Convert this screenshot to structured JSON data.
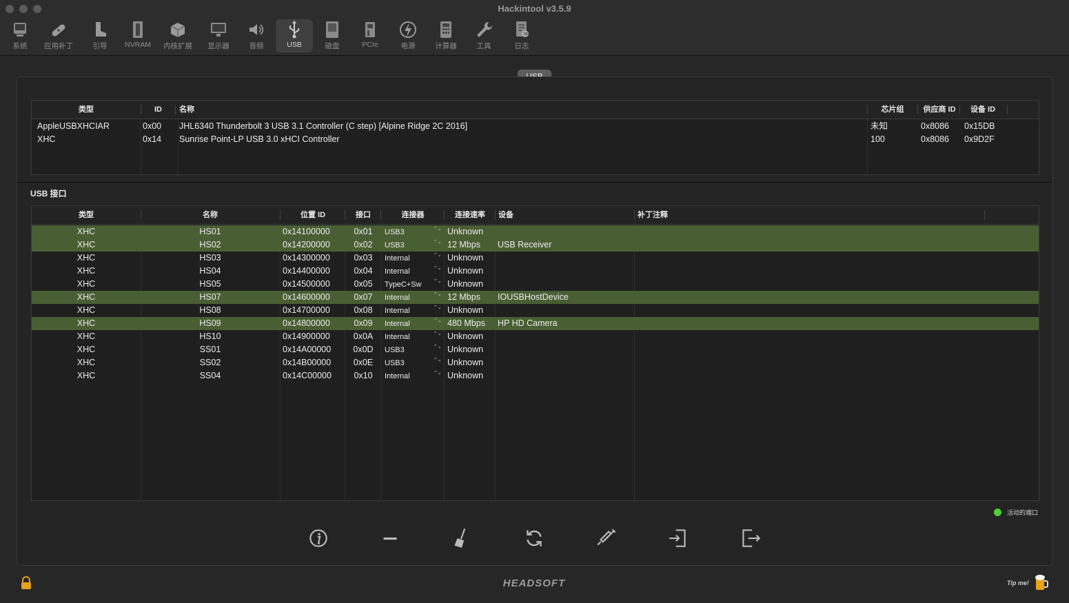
{
  "window": {
    "title": "Hackintool v3.5.9"
  },
  "toolbar": {
    "items": [
      {
        "label": "系统",
        "icon": "computer-icon"
      },
      {
        "label": "应用补丁",
        "icon": "bandage-icon"
      },
      {
        "label": "引导",
        "icon": "boot-icon"
      },
      {
        "label": "NVRAM",
        "icon": "nvram-chip-icon"
      },
      {
        "label": "内核扩展",
        "icon": "kext-box-icon"
      },
      {
        "label": "显示器",
        "icon": "display-icon"
      },
      {
        "label": "音频",
        "icon": "speaker-icon"
      },
      {
        "label": "USB",
        "icon": "usb-icon"
      },
      {
        "label": "磁盘",
        "icon": "disk-icon"
      },
      {
        "label": "PCIe",
        "icon": "pcie-card-icon"
      },
      {
        "label": "电源",
        "icon": "power-bolt-icon"
      },
      {
        "label": "计算器",
        "icon": "calculator-icon"
      },
      {
        "label": "工具",
        "icon": "wrench-icon"
      },
      {
        "label": "日志",
        "icon": "log-icon"
      }
    ],
    "active": "USB"
  },
  "panel": {
    "tab_label": "USB"
  },
  "controllers": {
    "headers": [
      "类型",
      "ID",
      "名称",
      "芯片组",
      "供应商 ID",
      "设备 ID"
    ],
    "rows": [
      [
        "AppleUSBXHCIAR",
        "0x00",
        "JHL6340 Thunderbolt 3 USB 3.1 Controller (C step) [Alpine Ridge 2C 2016]",
        "未知",
        "0x8086",
        "0x15DB"
      ],
      [
        "XHC",
        "0x14",
        "Sunrise Point-LP USB 3.0 xHCI Controller",
        "100",
        "0x8086",
        "0x9D2F"
      ]
    ]
  },
  "ports": {
    "section_title": "USB 接口",
    "headers": [
      "类型",
      "名称",
      "位置 ID",
      "接口",
      "连接器",
      "连接速率",
      "设备",
      "补丁注释"
    ],
    "rows": [
      {
        "cells": [
          "XHC",
          "HS01",
          "0x14100000",
          "0x01",
          "USB3",
          "Unknown",
          "",
          ""
        ],
        "active": true
      },
      {
        "cells": [
          "XHC",
          "HS02",
          "0x14200000",
          "0x02",
          "USB3",
          "12 Mbps",
          "USB Receiver",
          ""
        ],
        "active": true
      },
      {
        "cells": [
          "XHC",
          "HS03",
          "0x14300000",
          "0x03",
          "Internal",
          "Unknown",
          "",
          ""
        ],
        "active": false
      },
      {
        "cells": [
          "XHC",
          "HS04",
          "0x14400000",
          "0x04",
          "Internal",
          "Unknown",
          "",
          ""
        ],
        "active": false
      },
      {
        "cells": [
          "XHC",
          "HS05",
          "0x14500000",
          "0x05",
          "TypeC+Sw",
          "Unknown",
          "",
          ""
        ],
        "active": false
      },
      {
        "cells": [
          "XHC",
          "HS07",
          "0x14600000",
          "0x07",
          "Internal",
          "12 Mbps",
          "IOUSBHostDevice",
          ""
        ],
        "active": true
      },
      {
        "cells": [
          "XHC",
          "HS08",
          "0x14700000",
          "0x08",
          "Internal",
          "Unknown",
          "",
          ""
        ],
        "active": false
      },
      {
        "cells": [
          "XHC",
          "HS09",
          "0x14800000",
          "0x09",
          "Internal",
          "480 Mbps",
          "HP HD Camera",
          ""
        ],
        "active": true
      },
      {
        "cells": [
          "XHC",
          "HS10",
          "0x14900000",
          "0x0A",
          "Internal",
          "Unknown",
          "",
          ""
        ],
        "active": false
      },
      {
        "cells": [
          "XHC",
          "SS01",
          "0x14A00000",
          "0x0D",
          "USB3",
          "Unknown",
          "",
          ""
        ],
        "active": false
      },
      {
        "cells": [
          "XHC",
          "SS02",
          "0x14B00000",
          "0x0E",
          "USB3",
          "Unknown",
          "",
          ""
        ],
        "active": false
      },
      {
        "cells": [
          "XHC",
          "SS04",
          "0x14C00000",
          "0x10",
          "Internal",
          "Unknown",
          "",
          ""
        ],
        "active": false
      }
    ]
  },
  "legend": {
    "label": "活动的端口",
    "color": "#4cd137"
  },
  "colors": {
    "active_row": "#4a5e34",
    "background": "#272727"
  },
  "actions": [
    {
      "name": "info-button",
      "icon": "info-icon"
    },
    {
      "name": "remove-button",
      "icon": "minus-icon"
    },
    {
      "name": "clear-button",
      "icon": "broom-icon"
    },
    {
      "name": "refresh-button",
      "icon": "refresh-icon"
    },
    {
      "name": "inject-button",
      "icon": "syringe-icon"
    },
    {
      "name": "import-button",
      "icon": "import-icon"
    },
    {
      "name": "export-button",
      "icon": "export-icon"
    }
  ],
  "footer": {
    "brand": "HEADSOFT",
    "tip_label": "Tip me!"
  }
}
